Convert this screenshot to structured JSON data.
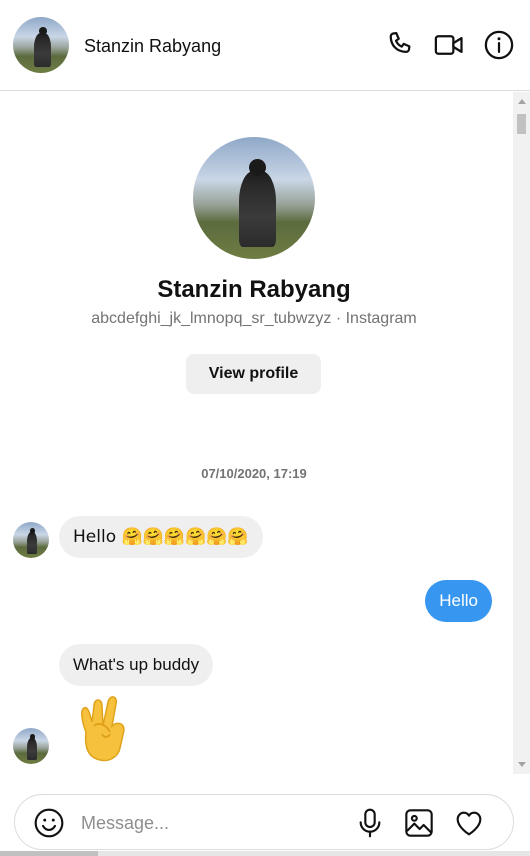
{
  "header": {
    "name": "Stanzin Rabyang",
    "icons": [
      "phone-icon",
      "video-camera-icon",
      "info-icon"
    ]
  },
  "profile": {
    "name": "Stanzin Rabyang",
    "subtitle": "abcdefghi_jk_lmnopq_sr_tubwzyz · Instagram",
    "view_profile_label": "View profile"
  },
  "conversation": {
    "timestamp": "07/10/2020, 17:19",
    "messages": [
      {
        "from": "them",
        "text": "Hello 🤗🤗🤗🤗🤗🤗"
      },
      {
        "from": "me",
        "text": "Hello"
      },
      {
        "from": "them",
        "text": "What's up buddy"
      },
      {
        "from": "them",
        "emoji": "🤘"
      }
    ]
  },
  "composer": {
    "placeholder": "Message...",
    "icons": [
      "emoji-icon",
      "microphone-icon",
      "image-icon",
      "heart-icon"
    ]
  },
  "colors": {
    "outgoing_bubble": "#3797f0",
    "incoming_bubble": "#efefef",
    "muted_text": "#737373",
    "border": "#dbdbdb"
  }
}
